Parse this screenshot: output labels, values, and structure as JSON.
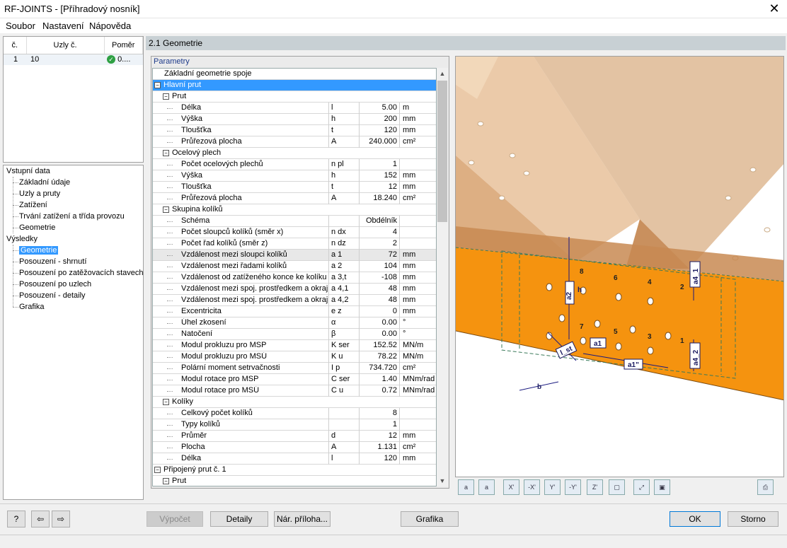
{
  "window": {
    "title": "RF-JOINTS - [Příhradový nosník]",
    "close_glyph": "✕"
  },
  "menu": [
    {
      "label": "Soubor"
    },
    {
      "label": "Nastavení"
    },
    {
      "label": "Nápověda"
    }
  ],
  "joints_table": {
    "headers": [
      "č.",
      "Uzly č.",
      "Poměr"
    ],
    "rows": [
      {
        "no": "1",
        "nodes": "10",
        "ratio": "0...."
      }
    ]
  },
  "nav": {
    "input_group": "Vstupní data",
    "input_items": [
      "Základní údaje",
      "Uzly a pruty",
      "Zatížení",
      "Trvání zatížení a třída provozu",
      "Geometrie"
    ],
    "results_group": "Výsledky",
    "results_items": [
      "Geometrie",
      "Posouzení - shrnutí",
      "Posouzení po zatěžovacích stavech",
      "Posouzení po uzlech",
      "Posouzení - detaily",
      "Grafika"
    ]
  },
  "section_title": "2.1 Geometrie",
  "params_label": "Parametry",
  "params": [
    {
      "lvl": 0,
      "name": "Základní geometrie spoje",
      "sym": "",
      "val": "",
      "unit": "",
      "box": ""
    },
    {
      "lvl": 0,
      "name": "Hlavní prut",
      "sym": "",
      "val": "",
      "unit": "",
      "box": "−",
      "sel": true
    },
    {
      "lvl": 1,
      "name": "Prut",
      "sym": "",
      "val": "",
      "unit": "",
      "box": "−"
    },
    {
      "lvl": 2,
      "name": "Délka",
      "sym": "l",
      "val": "5.00",
      "unit": "m"
    },
    {
      "lvl": 2,
      "name": "Výška",
      "sym": "h",
      "val": "200",
      "unit": "mm"
    },
    {
      "lvl": 2,
      "name": "Tloušťka",
      "sym": "t",
      "val": "120",
      "unit": "mm"
    },
    {
      "lvl": 2,
      "name": "Průřezová plocha",
      "sym": "A",
      "val": "240.000",
      "unit": "cm²"
    },
    {
      "lvl": 1,
      "name": "Ocelový plech",
      "sym": "",
      "val": "",
      "unit": "",
      "box": "−"
    },
    {
      "lvl": 2,
      "name": "Počet ocelových plechů",
      "sym": "n pl",
      "val": "1",
      "unit": ""
    },
    {
      "lvl": 2,
      "name": "Výška",
      "sym": "h",
      "val": "152",
      "unit": "mm"
    },
    {
      "lvl": 2,
      "name": "Tloušťka",
      "sym": "t",
      "val": "12",
      "unit": "mm"
    },
    {
      "lvl": 2,
      "name": "Průřezová plocha",
      "sym": "A",
      "val": "18.240",
      "unit": "cm²"
    },
    {
      "lvl": 1,
      "name": "Skupina kolíků",
      "sym": "",
      "val": "",
      "unit": "",
      "box": "−"
    },
    {
      "lvl": 2,
      "name": "Schéma",
      "sym": "",
      "val": "Obdélník",
      "unit": ""
    },
    {
      "lvl": 2,
      "name": "Počet sloupců kolíků (směr x)",
      "sym": "n dx",
      "val": "4",
      "unit": ""
    },
    {
      "lvl": 2,
      "name": "Počet řad kolíků (směr z)",
      "sym": "n dz",
      "val": "2",
      "unit": ""
    },
    {
      "lvl": 2,
      "name": "Vzdálenost mezi sloupci kolíků",
      "sym": "a 1",
      "val": "72",
      "unit": "mm",
      "hl": true
    },
    {
      "lvl": 2,
      "name": "Vzdálenost mezi řadami kolíků",
      "sym": "a 2",
      "val": "104",
      "unit": "mm"
    },
    {
      "lvl": 2,
      "name": "Vzdálenost od zatíženého konce ke kolíku",
      "sym": "a 3,t",
      "val": "-108",
      "unit": "mm"
    },
    {
      "lvl": 2,
      "name": "Vzdálenost mezi spoj. prostředkem a okraje",
      "sym": "a 4,1",
      "val": "48",
      "unit": "mm"
    },
    {
      "lvl": 2,
      "name": "Vzdálenost mezi spoj. prostředkem a okraje",
      "sym": "a 4,2",
      "val": "48",
      "unit": "mm"
    },
    {
      "lvl": 2,
      "name": "Excentricita",
      "sym": "e z",
      "val": "0",
      "unit": "mm"
    },
    {
      "lvl": 2,
      "name": "Úhel zkosení",
      "sym": "α",
      "val": "0.00",
      "unit": "°"
    },
    {
      "lvl": 2,
      "name": "Natočení",
      "sym": "β",
      "val": "0.00",
      "unit": "°"
    },
    {
      "lvl": 2,
      "name": "Modul prokluzu pro MSP",
      "sym": "K ser",
      "val": "152.52",
      "unit": "MN/m"
    },
    {
      "lvl": 2,
      "name": "Modul prokluzu pro MSÚ",
      "sym": "K u",
      "val": "78.22",
      "unit": "MN/m"
    },
    {
      "lvl": 2,
      "name": "Polární moment setrvačnosti",
      "sym": "I p",
      "val": "734.720",
      "unit": "cm²"
    },
    {
      "lvl": 2,
      "name": "Modul rotace pro MSP",
      "sym": "C ser",
      "val": "1.40",
      "unit": "MNm/rad"
    },
    {
      "lvl": 2,
      "name": "Modul rotace pro MSÚ",
      "sym": "C u",
      "val": "0.72",
      "unit": "MNm/rad"
    },
    {
      "lvl": 1,
      "name": "Kolíky",
      "sym": "",
      "val": "",
      "unit": "",
      "box": "−"
    },
    {
      "lvl": 2,
      "name": "Celkový počet kolíků",
      "sym": "",
      "val": "8",
      "unit": ""
    },
    {
      "lvl": 2,
      "name": "Typy kolíků",
      "sym": "",
      "val": "1",
      "unit": ""
    },
    {
      "lvl": 2,
      "name": "Průměr",
      "sym": "d",
      "val": "12",
      "unit": "mm"
    },
    {
      "lvl": 2,
      "name": "Plocha",
      "sym": "A",
      "val": "1.131",
      "unit": "cm²"
    },
    {
      "lvl": 2,
      "name": "Délka",
      "sym": "l",
      "val": "120",
      "unit": "mm"
    },
    {
      "lvl": 0,
      "name": "Připojený prut č. 1",
      "sym": "",
      "val": "",
      "unit": "",
      "box": "−"
    },
    {
      "lvl": 1,
      "name": "Prut",
      "sym": "",
      "val": "",
      "unit": "",
      "box": "−"
    }
  ],
  "graphic_labels": {
    "a4_1": "a4_1",
    "a4_2": "a4_2",
    "a2": "a2",
    "h": "h",
    "a1": "a1",
    "a1pp": "a1\"",
    "lst": "l_st",
    "b": "b",
    "dowel_numbers": [
      "8",
      "6",
      "4",
      "2",
      "7",
      "5",
      "3",
      "1"
    ]
  },
  "graphic_toolbar": [
    "dim-line",
    "dim-aligned",
    "view-x",
    "view-minus-x",
    "view-y",
    "view-minus-y",
    "view-z",
    "view-iso",
    "zoom-all",
    "select",
    "print"
  ],
  "graphic_toolbar_labels": [
    "a",
    "a",
    "X'",
    "-X'",
    "Y'",
    "-Y'",
    "Z'",
    "▢",
    "⤢",
    "▣",
    "⎙"
  ],
  "buttons": {
    "calc": "Výpočet",
    "details": "Detaily",
    "report": "Nár. příloha...",
    "graphics": "Grafika",
    "ok": "OK",
    "cancel": "Storno"
  },
  "colors": {
    "orange": "#f5930f",
    "timber": "#e3b17e",
    "selection": "#3399ff",
    "header": "#c8d0d4"
  }
}
